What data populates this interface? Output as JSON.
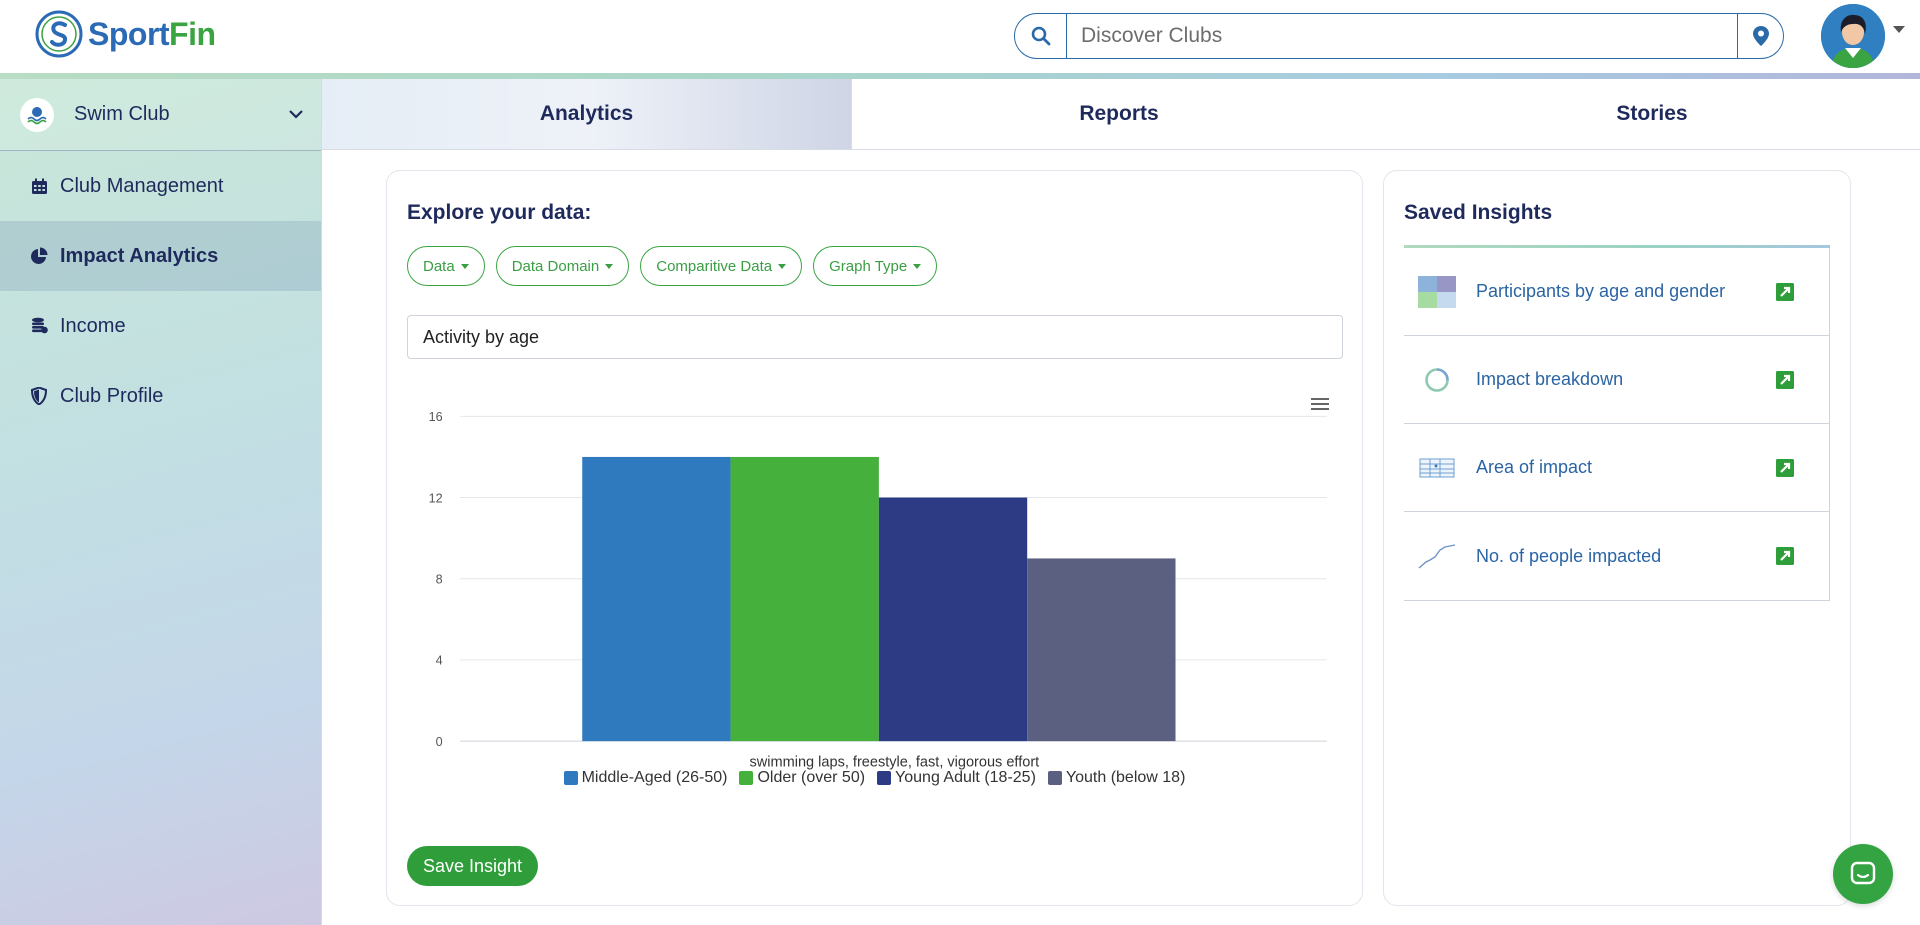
{
  "header": {
    "logo_sport": "Sport",
    "logo_fin": "Fin",
    "search_placeholder": "Discover Clubs"
  },
  "sidebar": {
    "club_name": "Swim Club",
    "items": [
      {
        "label": "Club Management",
        "icon": "calendar-icon"
      },
      {
        "label": "Impact Analytics",
        "icon": "pie-chart-icon",
        "active": true
      },
      {
        "label": "Income",
        "icon": "coins-icon"
      },
      {
        "label": "Club Profile",
        "icon": "shield-icon"
      }
    ]
  },
  "tabs": [
    {
      "label": "Analytics",
      "active": true
    },
    {
      "label": "Reports"
    },
    {
      "label": "Stories"
    }
  ],
  "explore": {
    "title": "Explore your data:",
    "filters": [
      "Data",
      "Data Domain",
      "Comparitive Data",
      "Graph Type"
    ],
    "chart_title_value": "Activity by age",
    "save_label": "Save Insight"
  },
  "insights": {
    "title": "Saved Insights",
    "items": [
      {
        "label": "Participants by age and gender",
        "icon": "heatmap-thumb-icon"
      },
      {
        "label": "Impact breakdown",
        "icon": "donut-thumb-icon"
      },
      {
        "label": "Area of impact",
        "icon": "table-thumb-icon"
      },
      {
        "label": "No. of people impacted",
        "icon": "line-thumb-icon"
      }
    ]
  },
  "colors": {
    "primary_green": "#3aa443",
    "navy": "#1f2a5c",
    "link_blue": "#2a64a5"
  },
  "chart_data": {
    "type": "bar",
    "categories": [
      "swimming laps, freestyle, fast, vigorous effort"
    ],
    "series": [
      {
        "name": "Middle-Aged (26-50)",
        "values": [
          14
        ],
        "color": "#2f7abf"
      },
      {
        "name": "Older (over 50)",
        "values": [
          14
        ],
        "color": "#46b03d"
      },
      {
        "name": "Young Adult (18-25)",
        "values": [
          12
        ],
        "color": "#2d3a84"
      },
      {
        "name": "Youth (below 18)",
        "values": [
          9
        ],
        "color": "#5b5f80"
      }
    ],
    "ylim": [
      0,
      16
    ],
    "yticks": [
      0,
      4,
      8,
      12,
      16
    ],
    "grid": true,
    "legend": "bottom"
  }
}
